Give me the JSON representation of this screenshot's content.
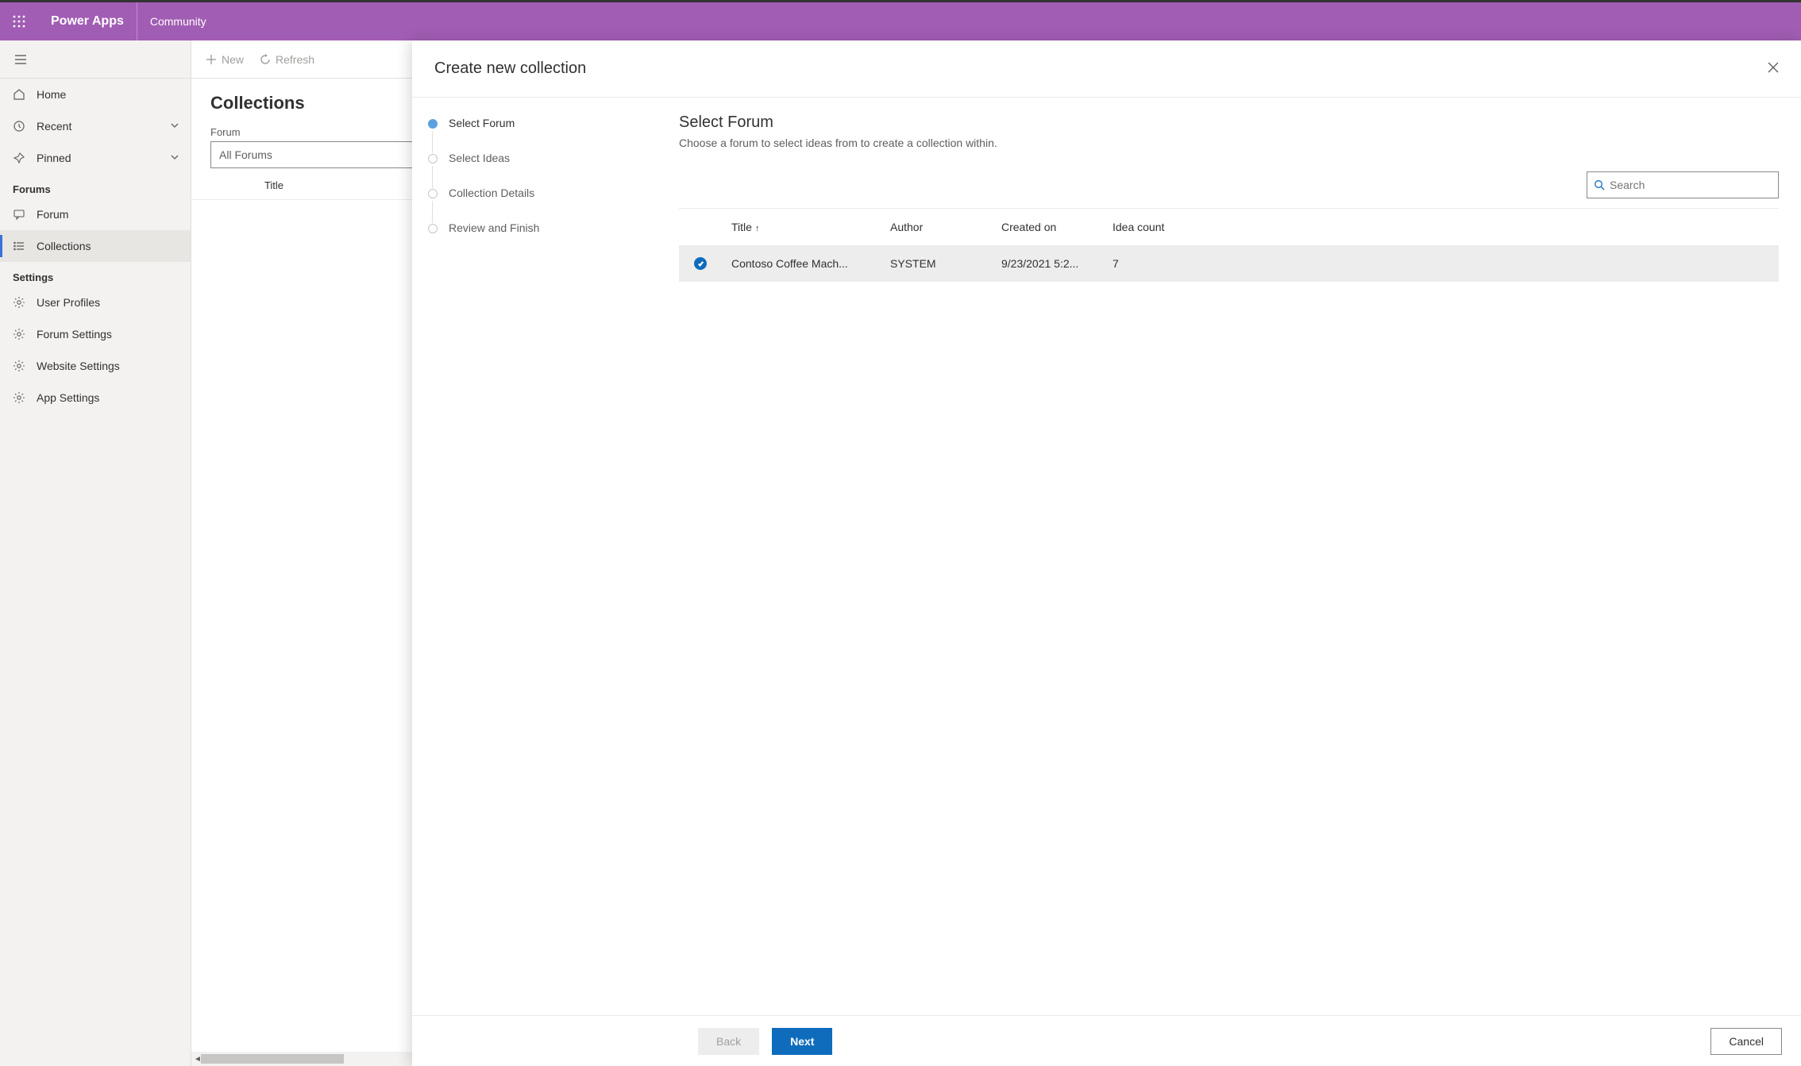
{
  "header": {
    "brand": "Power Apps",
    "area": "Community"
  },
  "nav": {
    "home": "Home",
    "recent": "Recent",
    "pinned": "Pinned",
    "sections": {
      "forums": {
        "label": "Forums",
        "items": {
          "forum": "Forum",
          "collections": "Collections"
        }
      },
      "settings": {
        "label": "Settings",
        "items": {
          "user_profiles": "User Profiles",
          "forum_settings": "Forum Settings",
          "website_settings": "Website Settings",
          "app_settings": "App Settings"
        }
      }
    }
  },
  "commands": {
    "new": "New",
    "refresh": "Refresh"
  },
  "page": {
    "title": "Collections",
    "filter_label": "Forum",
    "filter_value": "All Forums",
    "col_title": "Title"
  },
  "panel": {
    "title": "Create new collection",
    "steps": [
      "Select Forum",
      "Select Ideas",
      "Collection Details",
      "Review and Finish"
    ],
    "active_step": 0,
    "content": {
      "heading": "Select Forum",
      "sub": "Choose a forum to select ideas from to create a collection within.",
      "search_placeholder": "Search",
      "columns": {
        "title": "Title",
        "author": "Author",
        "created": "Created on",
        "count": "Idea count"
      },
      "rows": [
        {
          "selected": true,
          "title": "Contoso Coffee Mach...",
          "author": "SYSTEM",
          "created": "9/23/2021 5:2...",
          "count": "7"
        }
      ]
    },
    "footer": {
      "back": "Back",
      "next": "Next",
      "cancel": "Cancel"
    }
  }
}
